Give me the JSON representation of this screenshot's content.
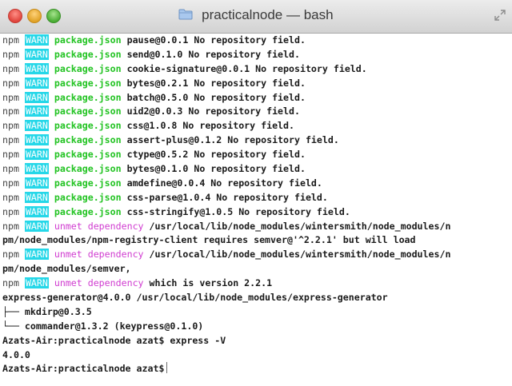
{
  "window": {
    "title": "practicalnode — bash",
    "icons": [
      "close-button",
      "minimize-button",
      "zoom-button",
      "folder-icon",
      "fullscreen-icon"
    ]
  },
  "colors": {
    "warn_bg": "#25d7e8",
    "package_json": "#22c322",
    "unmet_dependency": "#d03bd0"
  },
  "warn_lines": [
    {
      "npm": "npm",
      "warn": "WARN",
      "pkg": "package.json",
      "msg": "pause@0.0.1 No repository field."
    },
    {
      "npm": "npm",
      "warn": "WARN",
      "pkg": "package.json",
      "msg": "send@0.1.0 No repository field."
    },
    {
      "npm": "npm",
      "warn": "WARN",
      "pkg": "package.json",
      "msg": "cookie-signature@0.0.1 No repository field."
    },
    {
      "npm": "npm",
      "warn": "WARN",
      "pkg": "package.json",
      "msg": "bytes@0.2.1 No repository field."
    },
    {
      "npm": "npm",
      "warn": "WARN",
      "pkg": "package.json",
      "msg": "batch@0.5.0 No repository field."
    },
    {
      "npm": "npm",
      "warn": "WARN",
      "pkg": "package.json",
      "msg": "uid2@0.0.3 No repository field."
    },
    {
      "npm": "npm",
      "warn": "WARN",
      "pkg": "package.json",
      "msg": "css@1.0.8 No repository field."
    },
    {
      "npm": "npm",
      "warn": "WARN",
      "pkg": "package.json",
      "msg": "assert-plus@0.1.2 No repository field."
    },
    {
      "npm": "npm",
      "warn": "WARN",
      "pkg": "package.json",
      "msg": "ctype@0.5.2 No repository field."
    },
    {
      "npm": "npm",
      "warn": "WARN",
      "pkg": "package.json",
      "msg": "bytes@0.1.0 No repository field."
    },
    {
      "npm": "npm",
      "warn": "WARN",
      "pkg": "package.json",
      "msg": "amdefine@0.0.4 No repository field."
    },
    {
      "npm": "npm",
      "warn": "WARN",
      "pkg": "package.json",
      "msg": "css-parse@1.0.4 No repository field."
    },
    {
      "npm": "npm",
      "warn": "WARN",
      "pkg": "package.json",
      "msg": "css-stringify@1.0.5 No repository field."
    }
  ],
  "unmet_1": {
    "npm": "npm",
    "warn": "WARN",
    "label": "unmet dependency",
    "msg": "/usr/local/lib/node_modules/wintersmith/node_modules/n",
    "cont": "pm/node_modules/npm-registry-client requires semver@'^2.2.1' but will load"
  },
  "unmet_2": {
    "npm": "npm",
    "warn": "WARN",
    "label": "unmet dependency",
    "msg": "/usr/local/lib/node_modules/wintersmith/node_modules/n",
    "cont": "pm/node_modules/semver,"
  },
  "unmet_3": {
    "npm": "npm",
    "warn": "WARN",
    "label": "unmet dependency",
    "msg": "which is version 2.2.1"
  },
  "tree": {
    "root": "express-generator@4.0.0 /usr/local/lib/node_modules/express-generator",
    "child_1": "├── mkdirp@0.3.5",
    "child_2": "└── commander@1.3.2 (keypress@0.1.0)"
  },
  "prompt_1": "Azats-Air:practicalnode azat$ express -V",
  "output": "4.0.0",
  "prompt_2": "Azats-Air:practicalnode azat$"
}
